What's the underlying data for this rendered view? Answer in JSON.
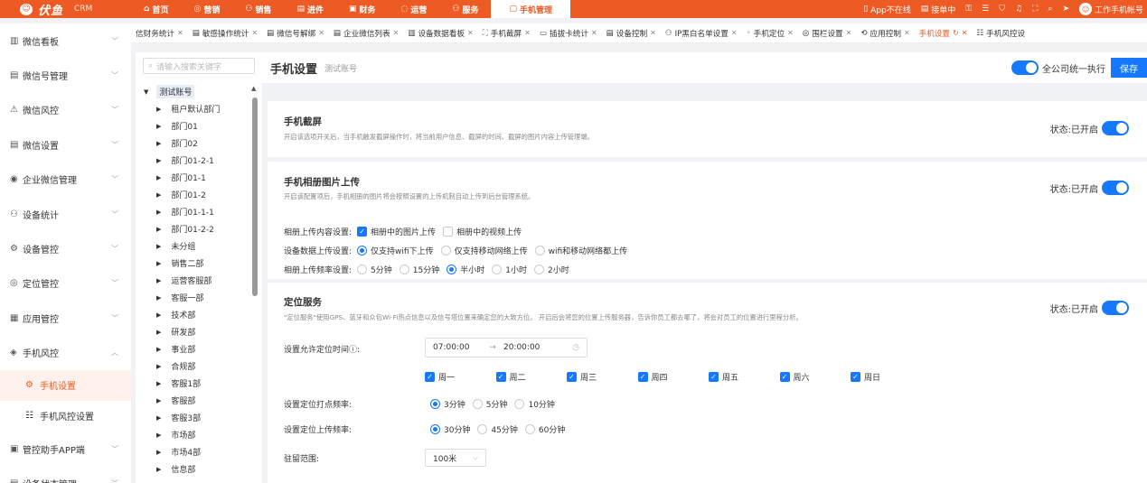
{
  "brand": {
    "logo_text": "伏鱼",
    "crm": "CRM"
  },
  "nav": [
    {
      "icon": "⌂",
      "label": "首页",
      "active": false
    },
    {
      "icon": "◎",
      "label": "营销",
      "active": false
    },
    {
      "icon": "⚇",
      "label": "销售",
      "active": false
    },
    {
      "icon": "▤",
      "label": "进件",
      "active": false
    },
    {
      "icon": "▣",
      "label": "财务",
      "active": false
    },
    {
      "icon": "◌",
      "label": "运营",
      "active": false
    },
    {
      "icon": "⚇",
      "label": "服务",
      "active": false
    },
    {
      "icon": "▢",
      "label": "手机管理",
      "active": true
    }
  ],
  "top_right": {
    "app_status": "App不在线",
    "orders": "接单中",
    "account": "工作手机帐号"
  },
  "sidebar": {
    "items": [
      {
        "icon": "▥",
        "label": "微信看板"
      },
      {
        "icon": "▤",
        "label": "微信号管理"
      },
      {
        "icon": "⚠",
        "label": "微信风控"
      },
      {
        "icon": "▤",
        "label": "微信设置"
      },
      {
        "icon": "◉",
        "label": "企业微信管理"
      },
      {
        "icon": "⚇",
        "label": "设备统计"
      },
      {
        "icon": "⚙",
        "label": "设备管控"
      },
      {
        "icon": "◎",
        "label": "定位管控"
      },
      {
        "icon": "▦",
        "label": "应用管控"
      },
      {
        "icon": "◈",
        "label": "手机风控"
      }
    ],
    "subitems": [
      {
        "icon": "⚙",
        "label": "手机设置",
        "active": true
      },
      {
        "icon": "☷",
        "label": "手机风控设置",
        "active": false
      }
    ],
    "bottom_items": [
      {
        "icon": "▣",
        "label": "管控助手APP端"
      },
      {
        "icon": "▤",
        "label": "设备状态管理"
      }
    ]
  },
  "tabs": [
    {
      "icon": "",
      "label": "信财务统计"
    },
    {
      "icon": "▤",
      "label": "敏感操作统计"
    },
    {
      "icon": "▤",
      "label": "微信号解绑"
    },
    {
      "icon": "▤",
      "label": "企业微信列表"
    },
    {
      "icon": "▥",
      "label": "设备数据看板"
    },
    {
      "icon": "⛶",
      "label": "手机截屏"
    },
    {
      "icon": "▭",
      "label": "插拔卡统计"
    },
    {
      "icon": "▤",
      "label": "设备控制"
    },
    {
      "icon": "⚇",
      "label": "IP黑白名单设置"
    },
    {
      "icon": "◦",
      "label": "手机定位"
    },
    {
      "icon": "◎",
      "label": "围栏设置"
    },
    {
      "icon": "⟲",
      "label": "应用控制"
    },
    {
      "icon": "",
      "label": "手机设置",
      "active": true
    },
    {
      "icon": "☷",
      "label": "手机风控设"
    }
  ],
  "tree": {
    "search_placeholder": "请输入搜索关键字",
    "root": "测试账号",
    "nodes": [
      "租户默认部门",
      "部门01",
      "部门02",
      "部门01-2-1",
      "部门01-1",
      "部门01-2",
      "部门01-1-1",
      "部门01-2-2",
      "未分组",
      "销售二部",
      "运营客服部",
      "客服一部",
      "技术部",
      "研发部",
      "事业部",
      "合规部",
      "客服1部",
      "客服部",
      "客服3部",
      "市场部",
      "市场4部",
      "信息部"
    ]
  },
  "header": {
    "title": "手机设置",
    "subtitle": "测试账号",
    "global_label": "全公司统一执行",
    "save": "保存"
  },
  "screenshot": {
    "title": "手机截屏",
    "desc": "开启该选项开关后，当手机触发截屏操作时，将当前用户信息、截屏的时间、截屏的图片内容上传管理端。",
    "status": "状态:已开启"
  },
  "album": {
    "title": "手机相册图片上传",
    "desc": "开启该配置项后，手机相册的图片将会按照设置的上传机制自动上传到后台管理系统。",
    "status": "状态:已开启",
    "content_label": "相册上传内容设置:",
    "content_opts": [
      {
        "label": "相册中的图片上传",
        "on": true
      },
      {
        "label": "相册中的视频上传",
        "on": false
      }
    ],
    "network_label": "设备数据上传设置:",
    "network_opts": [
      {
        "label": "仅支持wifi下上传",
        "on": true
      },
      {
        "label": "仅支持移动网络上传",
        "on": false
      },
      {
        "label": "wifi和移动网络都上传",
        "on": false
      }
    ],
    "freq_label": "相册上传频率设置:",
    "freq_opts": [
      {
        "label": "5分钟",
        "on": false
      },
      {
        "label": "15分钟",
        "on": false
      },
      {
        "label": "半小时",
        "on": true
      },
      {
        "label": "1小时",
        "on": false
      },
      {
        "label": "2小时",
        "on": false
      }
    ]
  },
  "location": {
    "title": "定位服务",
    "desc": "\"定位服务\"使用GPS、蓝牙和众包Wi-Fi热点信息以及信号塔位置来确定您的大致方位。 开启后会将您的位置上传服务器，告诉你员工都去哪了，将会对员工的位置进行里程分析。",
    "status": "状态:已开启",
    "time_label": "设置允许定位时间ⓘ:",
    "time_start": "07:00:00",
    "time_arrow": "→",
    "time_end": "20:00:00",
    "week": [
      "周一",
      "周二",
      "周三",
      "周四",
      "周五",
      "周六",
      "周日"
    ],
    "punch_label": "设置定位打点频率:",
    "punch_opts": [
      {
        "label": "3分钟",
        "on": true
      },
      {
        "label": "5分钟",
        "on": false
      },
      {
        "label": "10分钟",
        "on": false
      }
    ],
    "upload_label": "设置定位上传频率:",
    "upload_opts": [
      {
        "label": "30分钟",
        "on": true
      },
      {
        "label": "45分钟",
        "on": false
      },
      {
        "label": "60分钟",
        "on": false
      }
    ],
    "stay_label": "驻留范围:",
    "stay_value": "100米"
  }
}
